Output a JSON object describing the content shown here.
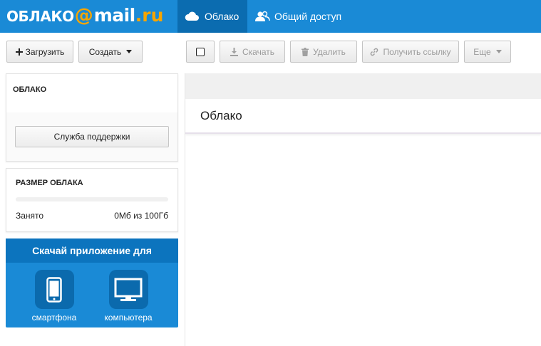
{
  "header": {
    "logo": {
      "part1": "ОБЛАКО",
      "at": "@",
      "part2": "mail",
      "dot_ru": ".ru"
    },
    "tabs": [
      {
        "label": "Облако",
        "icon": "cloud-icon",
        "active": true
      },
      {
        "label": "Общий доступ",
        "icon": "users-icon",
        "active": false
      }
    ],
    "colors": {
      "bar": "#1a8ad6",
      "active_tab": "#0b6cb0",
      "logo_accent": "#f6a500"
    }
  },
  "toolbar": {
    "upload": "Загрузить",
    "create": "Создать",
    "download": "Скачать",
    "delete": "Удалить",
    "get_link": "Получить ссылку",
    "more": "Еще"
  },
  "sidebar": {
    "cloud_title": "ОБЛАКО",
    "support_button": "Служба поддержки",
    "size": {
      "title": "РАЗМЕР ОБЛАКА",
      "used_label": "Занято",
      "used_value": "0Мб из 100Гб",
      "used_fraction": 0
    },
    "app": {
      "title": "Скачай приложение для",
      "items": [
        {
          "label": "смартфона",
          "icon": "smartphone-icon"
        },
        {
          "label": "компьютера",
          "icon": "monitor-icon"
        }
      ]
    }
  },
  "main": {
    "title": "Облако"
  }
}
